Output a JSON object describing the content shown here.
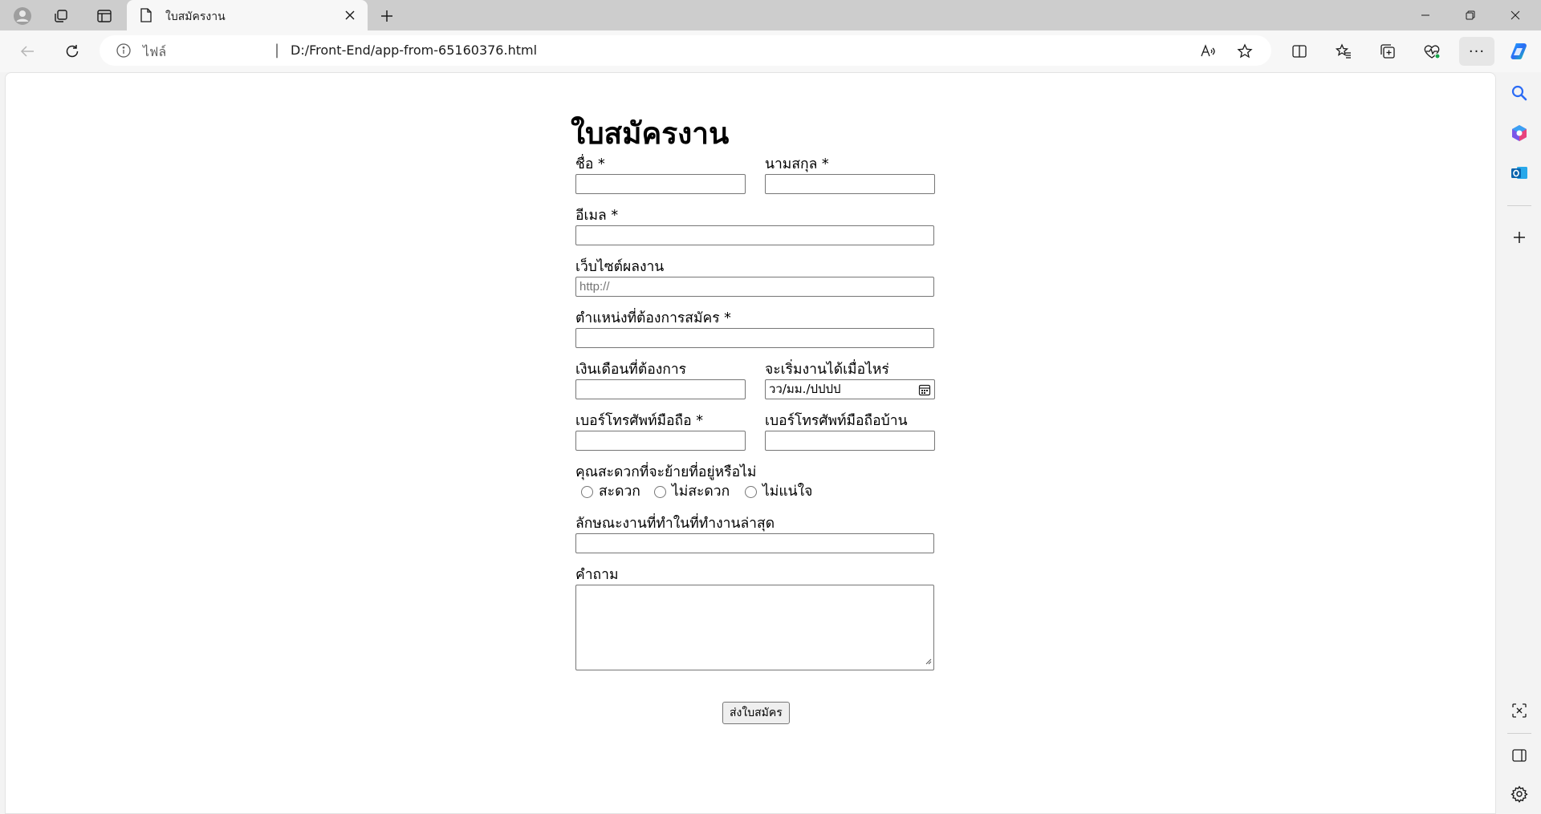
{
  "browser": {
    "tab_title": "ใบสมัครงาน",
    "address": {
      "scheme_label": "ไฟล์",
      "separator": "|",
      "url": "D:/Front-End/app-from-65160376.html"
    },
    "more_label": "···",
    "icons": [
      "profile-icon",
      "workspaces-icon",
      "vertical-tabs-icon",
      "page-icon",
      "close-icon",
      "plus-icon",
      "minimize-icon",
      "restore-icon",
      "back-icon",
      "refresh-icon",
      "info-icon",
      "read-aloud-icon",
      "favorite-star-icon",
      "split-screen-icon",
      "favorites-icon",
      "collections-icon",
      "browser-essentials-icon",
      "copilot-icon",
      "search-icon",
      "office-icon",
      "outlook-icon",
      "screenshot-icon",
      "sidebar-icon",
      "settings-icon"
    ]
  },
  "form": {
    "title": "ใบสมัครงาน",
    "first_name_label": "ชื่อ *",
    "last_name_label": "นามสกุล *",
    "email_label": "อีเมล *",
    "website_label": "เว็บไซต์ผลงาน",
    "website_placeholder": "http://",
    "position_label": "ตำแหน่งที่ต้องการสมัคร *",
    "salary_label": "เงินเดือนที่ต้องการ",
    "start_date_label": "จะเริ่มงานได้เมื่อไหร่",
    "start_date_placeholder": "วว/มม./ปปปป",
    "mobile_label": "เบอร์โทรศัพท์มือถือ *",
    "home_phone_label": "เบอร์โทรศัพท์มือถือบ้าน",
    "relocate_label": "คุณสะดวกที่จะย้ายที่อยู่หรือไม่",
    "relocate_options": [
      "สะดวก",
      "ไม่สะดวก",
      "ไม่แน่ใจ"
    ],
    "last_job_label": "ลักษณะงานที่ทำในที่ทำงานล่าสุด",
    "question_label": "คำถาม",
    "submit_label": "ส่งใบสมัคร"
  }
}
